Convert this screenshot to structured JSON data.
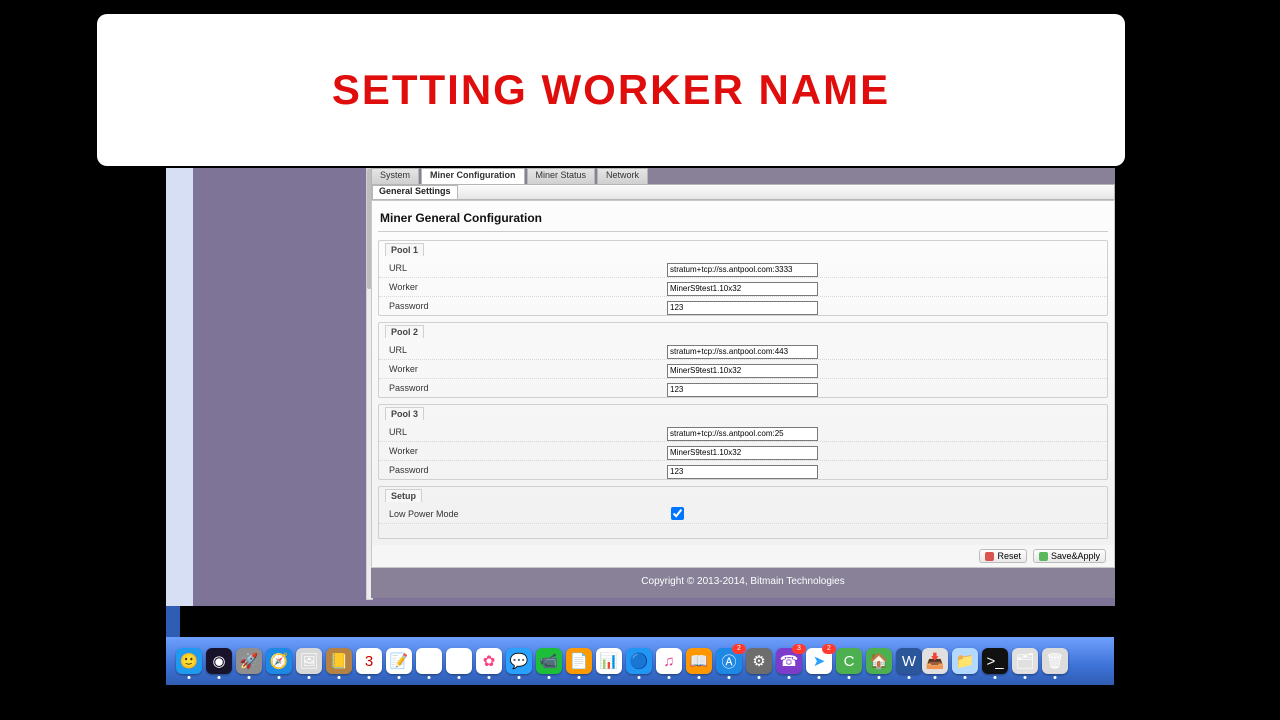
{
  "title_card": "SETTING WORKER NAME",
  "tabs": {
    "system": "System",
    "miner_conf": "Miner Configuration",
    "miner_status": "Miner Status",
    "network": "Network"
  },
  "subtab": "General Settings",
  "page_title": "Miner General Configuration",
  "pools": [
    {
      "legend": "Pool 1",
      "url_label": "URL",
      "url": "stratum+tcp://ss.antpool.com:3333",
      "worker_label": "Worker",
      "worker": "MinerS9test1.10x32",
      "password_label": "Password",
      "password": "123"
    },
    {
      "legend": "Pool 2",
      "url_label": "URL",
      "url": "stratum+tcp://ss.antpool.com:443",
      "worker_label": "Worker",
      "worker": "MinerS9test1.10x32",
      "password_label": "Password",
      "password": "123"
    },
    {
      "legend": "Pool 3",
      "url_label": "URL",
      "url": "stratum+tcp://ss.antpool.com:25",
      "worker_label": "Worker",
      "worker": "MinerS9test1.10x32",
      "password_label": "Password",
      "password": "123"
    }
  ],
  "setup": {
    "legend": "Setup",
    "low_power_label": "Low Power Mode",
    "low_power_checked": true
  },
  "buttons": {
    "reset": "Reset",
    "save": "Save&Apply"
  },
  "footer": "Copyright © 2013-2014, Bitmain Technologies",
  "dock": {
    "apps": [
      {
        "name": "finder-icon",
        "bg": "#1e9bf0",
        "glyph": "🙂"
      },
      {
        "name": "siri-icon",
        "bg": "#18122b",
        "glyph": "◉"
      },
      {
        "name": "launchpad-icon",
        "bg": "#8f8f8f",
        "glyph": "🚀"
      },
      {
        "name": "safari-icon",
        "bg": "#1e88e5",
        "glyph": "🧭"
      },
      {
        "name": "preview-icon",
        "bg": "#d7d7d7",
        "glyph": "🖼"
      },
      {
        "name": "contacts-icon",
        "bg": "#b58245",
        "glyph": "📒"
      },
      {
        "name": "calendar-icon",
        "bg": "#ffffff",
        "glyph": "3",
        "text_color": "#cc0000"
      },
      {
        "name": "notes-icon",
        "bg": "#ffffff",
        "glyph": "📝"
      },
      {
        "name": "maps-icon",
        "bg": "#ffffff",
        "glyph": "🗺"
      },
      {
        "name": "reminders-icon",
        "bg": "#ffffff",
        "glyph": "☑"
      },
      {
        "name": "photos-icon",
        "bg": "#ffffff",
        "glyph": "✿",
        "text_color": "#ff4081"
      },
      {
        "name": "messages-icon",
        "bg": "#2aa1ff",
        "glyph": "💬"
      },
      {
        "name": "facetime-icon",
        "bg": "#1dbf3a",
        "glyph": "📹"
      },
      {
        "name": "pages-icon",
        "bg": "#ff9900",
        "glyph": "📄"
      },
      {
        "name": "numbers-icon",
        "bg": "#ffffff",
        "glyph": "📊"
      },
      {
        "name": "keynote-icon",
        "bg": "#2196f3",
        "glyph": "🔵"
      },
      {
        "name": "itunes-icon",
        "bg": "#ffffff",
        "glyph": "♫",
        "text_color": "#e83e8c"
      },
      {
        "name": "ibooks-icon",
        "bg": "#ff9800",
        "glyph": "📖"
      },
      {
        "name": "appstore-icon",
        "bg": "#1e88e5",
        "glyph": "Ⓐ",
        "badge": "2"
      },
      {
        "name": "settings-icon",
        "bg": "#6d6d6d",
        "glyph": "⚙"
      },
      {
        "name": "viber-icon",
        "bg": "#7d3cca",
        "glyph": "☎",
        "badge": "3"
      },
      {
        "name": "telegram-icon",
        "bg": "#ffffff",
        "glyph": "➤",
        "text_color": "#2aa1ff",
        "badge": "2"
      },
      {
        "name": "camtasia-icon",
        "bg": "#4caf50",
        "glyph": "C"
      },
      {
        "name": "app-generic-icon",
        "bg": "#4caf50",
        "glyph": "🏠"
      },
      {
        "name": "word-icon",
        "bg": "#2b579a",
        "glyph": "W"
      }
    ],
    "right": [
      {
        "name": "downloads-icon",
        "bg": "#e0e0e0",
        "glyph": "📥"
      },
      {
        "name": "folder-icon",
        "bg": "#b3d9ff",
        "glyph": "📁"
      },
      {
        "name": "terminal-icon",
        "bg": "#111",
        "glyph": ">_"
      },
      {
        "name": "stack-icon",
        "bg": "#e0e0e0",
        "glyph": "🗂"
      },
      {
        "name": "trash-icon",
        "bg": "#dcdcdc",
        "glyph": "🗑"
      }
    ]
  }
}
